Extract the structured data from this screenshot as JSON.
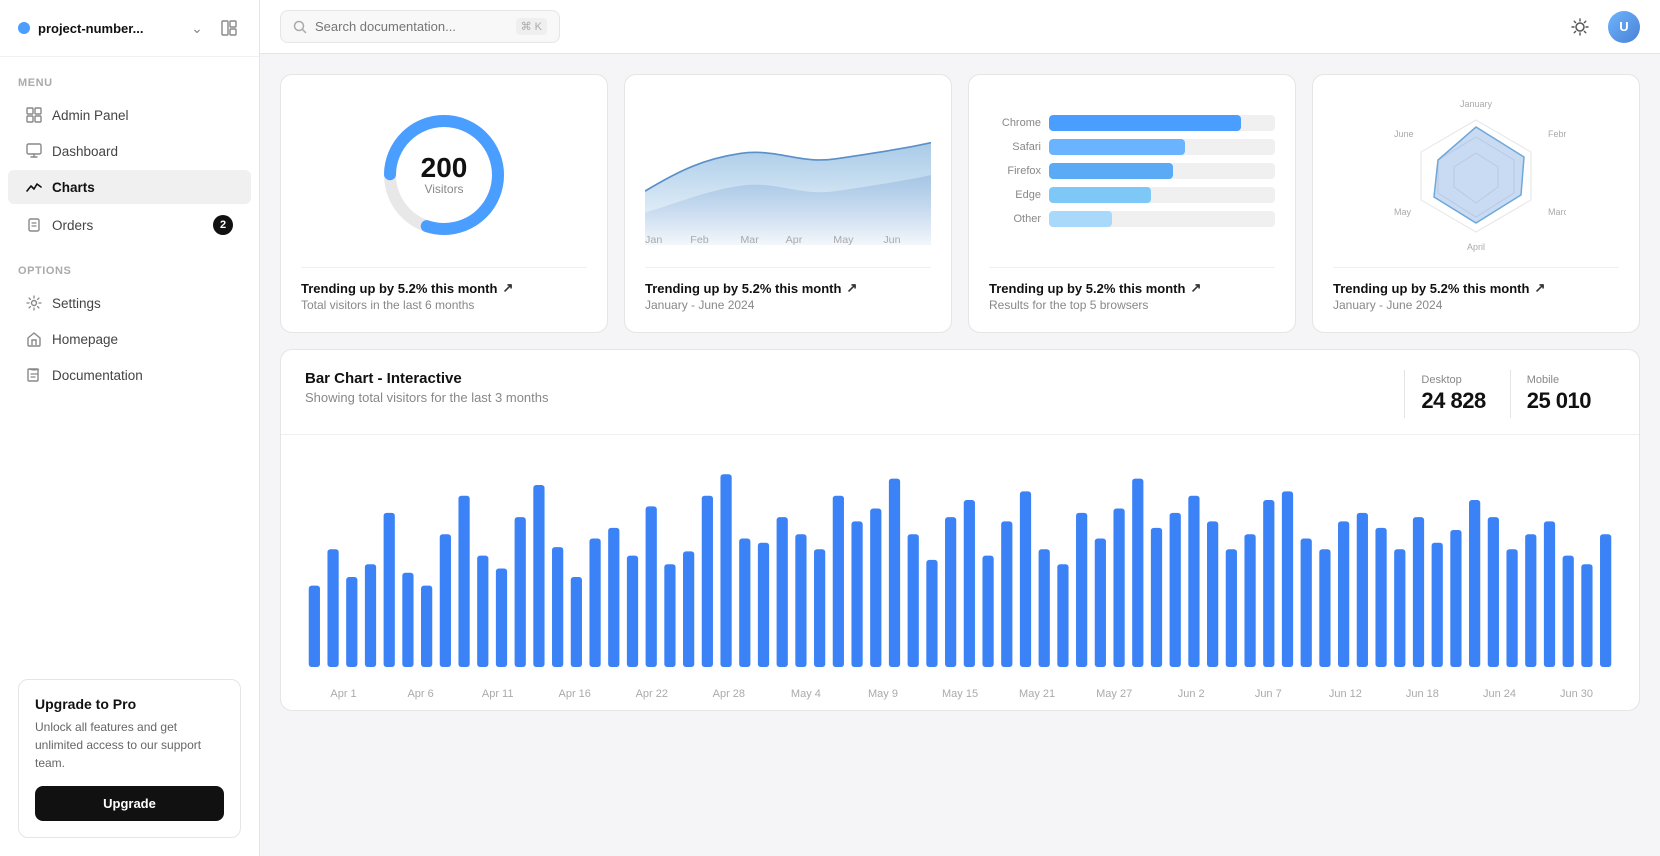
{
  "sidebar": {
    "project_name": "project-number...",
    "menu_label": "MENU",
    "options_label": "OPTIONS",
    "items_menu": [
      {
        "id": "admin-panel",
        "label": "Admin Panel",
        "icon": "layout"
      },
      {
        "id": "dashboard",
        "label": "Dashboard",
        "icon": "grid"
      },
      {
        "id": "charts",
        "label": "Charts",
        "icon": "chart",
        "active": true
      },
      {
        "id": "orders",
        "label": "Orders",
        "icon": "box",
        "badge": "2"
      }
    ],
    "items_options": [
      {
        "id": "settings",
        "label": "Settings",
        "icon": "gear"
      },
      {
        "id": "homepage",
        "label": "Homepage",
        "icon": "home"
      },
      {
        "id": "documentation",
        "label": "Documentation",
        "icon": "book"
      }
    ]
  },
  "upgrade": {
    "title": "Upgrade to Pro",
    "description": "Unlock all features and get unlimited access to our support team.",
    "button_label": "Upgrade"
  },
  "topbar": {
    "search_placeholder": "Search documentation...",
    "search_shortcut": "⌘ K"
  },
  "cards": [
    {
      "id": "visitors-donut",
      "value": "200",
      "label": "Visitors",
      "trending": "Trending up by 5.2% this month",
      "subtitle": "Total visitors in the last 6 months"
    },
    {
      "id": "area-chart",
      "trending": "Trending up by 5.2% this month",
      "subtitle": "January - June 2024",
      "x_labels": [
        "Jan",
        "Feb",
        "Mar",
        "Apr",
        "May",
        "Jun"
      ]
    },
    {
      "id": "browser-bar",
      "trending": "Trending up by 5.2% this month",
      "subtitle": "Results for the top 5 browsers",
      "browsers": [
        {
          "name": "Chrome",
          "pct": 85
        },
        {
          "name": "Safari",
          "pct": 60
        },
        {
          "name": "Firefox",
          "pct": 55
        },
        {
          "name": "Edge",
          "pct": 45
        },
        {
          "name": "Other",
          "pct": 28
        }
      ]
    },
    {
      "id": "radar-chart",
      "trending": "Trending up by 5.2% this month",
      "subtitle": "January - June 2024",
      "months": [
        "January",
        "February",
        "March",
        "April",
        "May",
        "June"
      ]
    }
  ],
  "bar_section": {
    "title": "Bar Chart - Interactive",
    "subtitle": "Showing total visitors for the last 3 months",
    "desktop_label": "Desktop",
    "desktop_value": "24 828",
    "mobile_label": "Mobile",
    "mobile_value": "25 010",
    "x_labels": [
      "Apr 1",
      "Apr 6",
      "Apr 11",
      "Apr 16",
      "Apr 22",
      "Apr 28",
      "May 4",
      "May 9",
      "May 15",
      "May 21",
      "May 27",
      "Jun 2",
      "Jun 7",
      "Jun 12",
      "Jun 18",
      "Jun 24",
      "Jun 30"
    ],
    "bar_data": [
      38,
      55,
      42,
      48,
      72,
      44,
      38,
      62,
      80,
      52,
      46,
      70,
      85,
      56,
      42,
      60,
      65,
      52,
      75,
      48,
      54,
      80,
      90,
      60,
      58,
      70,
      62,
      55,
      80,
      68,
      74,
      88,
      62,
      50,
      70,
      78,
      52,
      68,
      82,
      55,
      48,
      72,
      60,
      74,
      88,
      65,
      72,
      80,
      68,
      55,
      62,
      78,
      82,
      60,
      55,
      68,
      72,
      65,
      55,
      70,
      58,
      64,
      78,
      70,
      55,
      62,
      68,
      52,
      48,
      62
    ]
  },
  "colors": {
    "accent_blue": "#4a9eff",
    "bar_blue": "#3b82f6",
    "area_blue": "#6ea8d8",
    "area_fill": "rgba(100,150,220,0.25)",
    "active_bg": "#f0f0f0"
  }
}
